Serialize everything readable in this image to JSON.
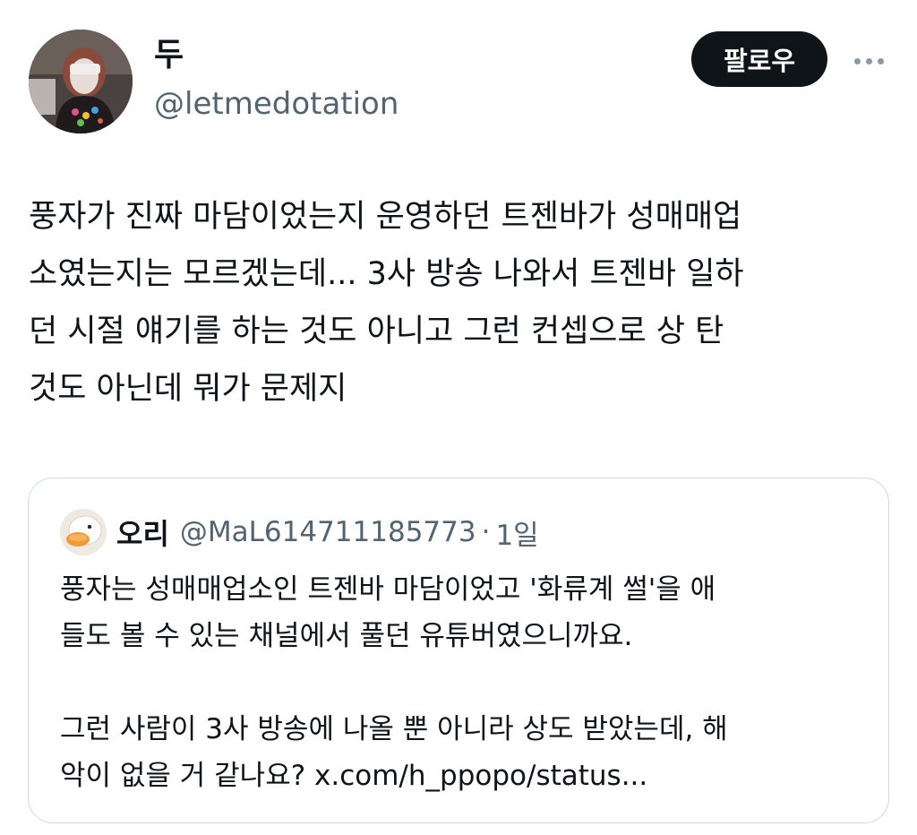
{
  "author": {
    "name": "두",
    "handle": "@letmedotation"
  },
  "follow_button": {
    "label": "팔로우"
  },
  "more_button": {
    "icon": "more-horizontal-icon"
  },
  "tweet": {
    "text": "풍자가 진짜 마담이었는지 운영하던 트젠바가 성매매업\n소였는지는 모르겠는데... 3사 방송 나와서 트젠바 일하\n던 시절 얘기를 하는 것도 아니고 그런 컨셉으로 상 탄\n것도 아닌데 뭐가 문제지"
  },
  "quote": {
    "name": "오리",
    "handle": "@MaL614711185773",
    "separator": "·",
    "time": "1일",
    "text": "풍자는 성매매업소인 트젠바 마담이었고 '화류계 썰'을 애\n들도 볼 수 있는 채널에서 풀던 유튜버였으니까요.\n\n그런 사람이 3사 방송에 나올 뿐 아니라 상도 받았는데, 해\n악이 없을 거 같나요? x.com/h_ppopo/status..."
  },
  "colors": {
    "text": "#0f1419",
    "secondary": "#536471",
    "border": "#cfd9de",
    "button_bg": "#0f1419",
    "button_text": "#ffffff"
  }
}
